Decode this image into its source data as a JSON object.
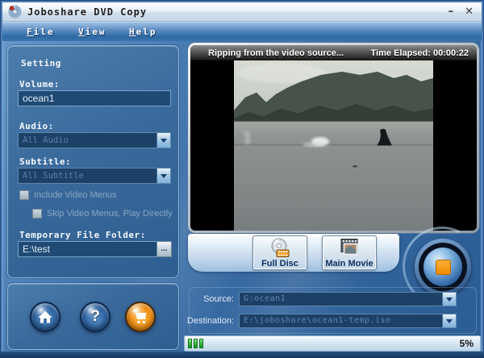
{
  "window": {
    "title": "Joboshare DVD Copy",
    "minimize_glyph": "–",
    "close_glyph": "✕"
  },
  "menu": {
    "items": [
      {
        "label": "File"
      },
      {
        "label": "View"
      },
      {
        "label": "Help"
      }
    ]
  },
  "settings": {
    "heading": "Setting",
    "volume_label": "Volume:",
    "volume_value": "ocean1",
    "audio_label": "Audio:",
    "audio_value": "All Audio",
    "subtitle_label": "Subtitle:",
    "subtitle_value": "All Subtitle",
    "include_video_menus_label": "Include Video Menus",
    "skip_video_menus_label": "Skip Video Menus, Play Directly",
    "temp_folder_label": "Temporary File Folder:",
    "temp_folder_value": "E:\\test",
    "browse_button_label": "..."
  },
  "preview": {
    "status_text": "Ripping from the video source...",
    "time_elapsed": "Time Elapsed: 00:00:22"
  },
  "modes": {
    "full_disc_label": "Full Disc",
    "main_movie_label": "Main Movie"
  },
  "toolbar": {
    "help_glyph": "?"
  },
  "output": {
    "source_label": "Source:",
    "source_value": "G:ocean1",
    "destination_label": "Destination:",
    "destination_value": "E:\\joboshare\\ocean1-temp.iso"
  },
  "statusbar": {
    "progress_percent": "5%",
    "progress_blocks": 3
  },
  "colors": {
    "accent_orange": "#f08a00",
    "progress_green": "#3dbb3d",
    "panel_blue": "#35679f"
  }
}
